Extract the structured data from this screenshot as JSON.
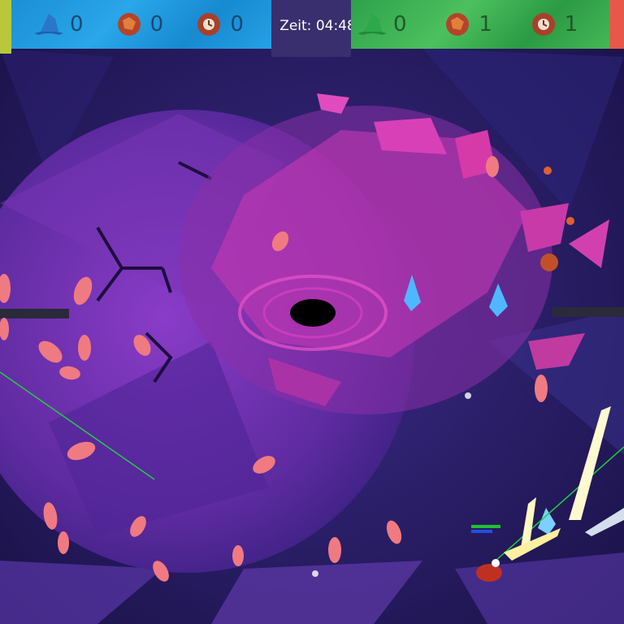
{
  "hud": {
    "timer": "Zeit: 04:48",
    "team_blue": {
      "color": "#1b8fd6",
      "slots": [
        {
          "icon": "wizard-hat-icon",
          "count": "0"
        },
        {
          "icon": "fire-rock-icon",
          "count": "0"
        },
        {
          "icon": "rock-clock-icon",
          "count": "0"
        }
      ]
    },
    "team_green": {
      "color": "#2ea24a",
      "slots": [
        {
          "icon": "wizard-hat-icon",
          "count": "0"
        },
        {
          "icon": "fire-rock-icon",
          "count": "1"
        },
        {
          "icon": "rock-clock-icon",
          "count": "1"
        }
      ]
    }
  },
  "colors": {
    "space": "#1c1452",
    "arena": "#6a2fa6",
    "vortex": "#e040c0",
    "crystal": "#4fb7ff",
    "petal": "#f0707a",
    "health": "#20c030",
    "mana": "#2050e0"
  }
}
